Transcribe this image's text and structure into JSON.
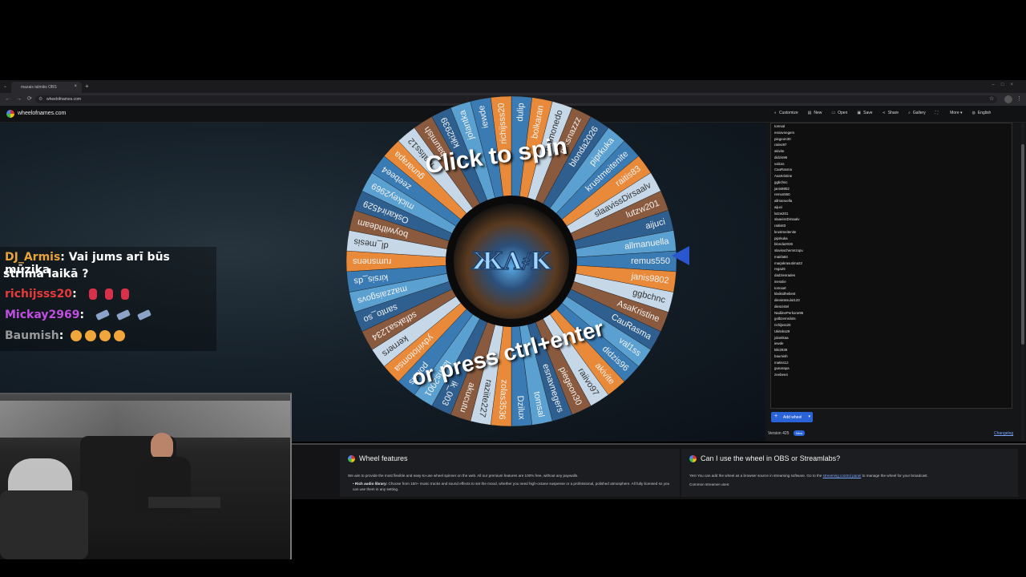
{
  "browser": {
    "tab_title": "mazais talmiks OBS",
    "url": "wheelofnames.com"
  },
  "app": {
    "brand": "wheelofnames.com",
    "menu": [
      {
        "icon": "palette-icon",
        "label": "Customize"
      },
      {
        "icon": "file-new-icon",
        "label": "New"
      },
      {
        "icon": "folder-open-icon",
        "label": "Open"
      },
      {
        "icon": "save-icon",
        "label": "Save"
      },
      {
        "icon": "share-icon",
        "label": "Share"
      },
      {
        "icon": "search-icon",
        "label": "Gallery"
      },
      {
        "icon": "fullscreen-icon",
        "label": ""
      },
      {
        "icon": "chevron-down-icon",
        "label": "More"
      },
      {
        "icon": "globe-icon",
        "label": "English"
      }
    ]
  },
  "wheel": {
    "click_text": "Click to spin",
    "press_text": "or press ctrl+enter",
    "colors": [
      "#3b7bb3",
      "#e88a3a",
      "#c6d8e8",
      "#8a5a3e",
      "#2f5f8f",
      "#5aa0d0"
    ],
    "slices": [
      "dulip",
      "bolkaran",
      "mamonedo",
      "ruksnazzz",
      "blonda2026",
      "piprkuka",
      "krustmeitenite",
      "raitis83",
      "slaavissDirsaalv",
      "lutzw201",
      "aijuci",
      "allmanuella",
      "remus550",
      "janis9802",
      "ggbchnc",
      "AsaKristine",
      "CauRasma",
      "val1ss",
      "didzis96",
      "akivite",
      "raiivo97",
      "piegeon30",
      "esnavnegers",
      "tomsal",
      "Dzilux",
      "zolas3536",
      "raziite227",
      "akucutu",
      "ik_003",
      "lauris2001",
      "poleris",
      "ydvirlotomsa",
      "kerners",
      "sdfaksa1234",
      "santo_so",
      "mazzaisgovs",
      "kirsis_ds",
      "rumsnens",
      "dl_mesis",
      "boywithdeam",
      "Oskarir4529",
      "mickey2969",
      "zeebee4",
      "gunarapa",
      "matiss12",
      "baumish",
      "kiki2939",
      "jolantka",
      "iewde",
      "richijsss20"
    ],
    "pointer_icon": "pointer-arrow-icon"
  },
  "entries": [
    "tomsal",
    "esnavnegers",
    "piegeon30",
    "raiivo97",
    "akivite",
    "didzis96",
    "val1ss",
    "CauRasma",
    "AsaKristine",
    "ggbchnc",
    "janis9802",
    "remus550",
    "allmanuella",
    "aijuci",
    "lutzw201",
    "slaavissDirsaalv",
    "raitis83",
    "krustmeitenite",
    "piprkuka",
    "blonda2026",
    "slavisschemnzopu",
    "mairla84",
    "marjakrasutima22",
    "rega26",
    "dadziesrades",
    "inesslie",
    "tomsart",
    "klaiksithebest",
    "dievietesulut123",
    "diescistel",
    "NadiinePerkone96",
    "golbzemsilots",
    "richijsss20",
    "Ukitnks29",
    "jolantkaa",
    "iewde",
    "kiki2939",
    "baumish",
    "matiss12",
    "gunarapa",
    "zeebee4"
  ],
  "panel": {
    "add_wheel_label": "Add wheel",
    "version_text": "Version 425",
    "new_badge": "New",
    "changelog_label": "Changelog"
  },
  "cards": {
    "features": {
      "title": "Wheel features",
      "intro": "We aim to provide the most flexible and easy-to-use wheel spinner on the web. All our premium features are 100% free, without any paywalls.",
      "bullet_title": "Rich audio library:",
      "bullet_text": "Choose from 150+ music tracks and sound effects to set the mood, whether you need high-octane suspense or a professional, polished atmosphere. All fully licensed so you can use them in any setting."
    },
    "obs": {
      "title": "Can I use the wheel in OBS or Streamlabs?",
      "text_before": "Yes! You can add the wheel as a browser source in streaming software. Go to the",
      "link": "streaming control panel",
      "text_after": "to manage the wheel for your broadcast.",
      "sub": "Common streamer uses:"
    }
  },
  "chat": [
    {
      "user": "DJ_Armis",
      "color": "#e8a33c",
      "message": ": Vai jums arī būs mūzika",
      "message2": "strīma laikā ?"
    },
    {
      "user": "richijsss20",
      "color": "#e83a3a",
      "message": ":"
    },
    {
      "user": "Mickay2969",
      "color": "#c04ee0",
      "message": ":"
    },
    {
      "user": "Baumish",
      "color": "#9a9a9a",
      "message": ":"
    }
  ]
}
